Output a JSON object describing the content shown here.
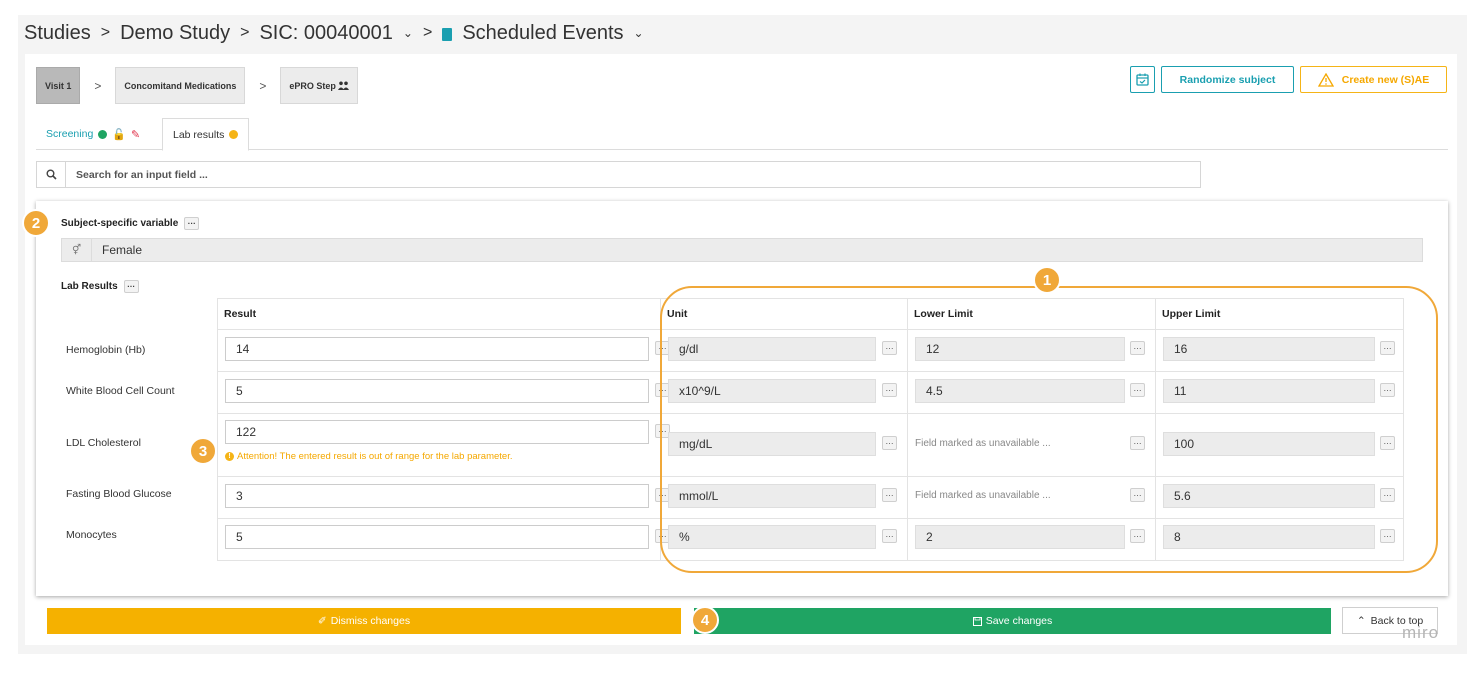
{
  "breadcrumb": {
    "studies": "Studies",
    "study": "Demo Study",
    "sic": "SIC: 00040001",
    "events": "Scheduled Events",
    "sep": ">",
    "chevron": "⌄"
  },
  "steps": [
    {
      "label": "Visit 1",
      "active": true
    },
    {
      "label": "Concomitand Medications",
      "active": false
    },
    {
      "label": "ePRO Step",
      "active": false
    }
  ],
  "step_arrow": ">",
  "actions": {
    "randomize": "Randomize subject",
    "create_ae": "Create new (S)AE"
  },
  "tabs": [
    {
      "label": "Screening"
    },
    {
      "label": "Lab results"
    }
  ],
  "search": {
    "placeholder": "Search for an input field ..."
  },
  "subject_var": {
    "label": "Subject-specific variable",
    "value": "Female"
  },
  "lab": {
    "label": "Lab Results",
    "headers": [
      "Result",
      "Unit",
      "Lower Limit",
      "Upper Limit"
    ],
    "rows": [
      {
        "name": "Hemoglobin (Hb)",
        "result": "14",
        "unit": "g/dl",
        "lower": "12",
        "upper": "16"
      },
      {
        "name": "White Blood Cell Count",
        "result": "5",
        "unit": "x10^9/L",
        "lower": "4.5",
        "upper": "11"
      },
      {
        "name": "LDL Cholesterol",
        "result": "122",
        "unit": "mg/dL",
        "lower": "Field marked as unavailable ...",
        "upper": "100",
        "warning": "Attention! The entered result is out of range for the lab parameter."
      },
      {
        "name": "Fasting Blood Glucose",
        "result": "3",
        "unit": "mmol/L",
        "lower": "Field marked as unavailable ...",
        "upper": "5.6"
      },
      {
        "name": "Monocytes",
        "result": "5",
        "unit": "%",
        "lower": "2",
        "upper": "8"
      }
    ]
  },
  "mini_btn": "···",
  "footer": {
    "dismiss": "Dismiss changes",
    "save": "Save changes",
    "back_to_top": "Back to top"
  },
  "badges": [
    "1",
    "2",
    "3",
    "4"
  ],
  "watermark": "miro",
  "colors": {
    "accent": "#1a9fb0",
    "warning": "#f5b100",
    "success": "#1fa463",
    "annotation": "#f0a839"
  }
}
